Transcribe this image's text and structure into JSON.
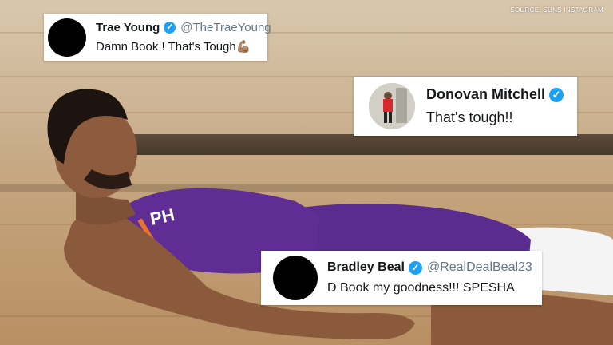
{
  "source_credit": "SOURCE: SUNS INSTAGRAM",
  "tweets": [
    {
      "name": "Trae Young",
      "handle": "@TheTraeYoung",
      "text": "Damn Book ! That's Tough",
      "emoji": "💪🏽",
      "verified_icon": "verified-badge-icon"
    },
    {
      "name": "Donovan Mitchell",
      "handle": "",
      "text": "That's tough!!",
      "verified_icon": "verified-badge-icon"
    },
    {
      "name": "Bradley Beal",
      "handle": "@RealDealBeal23",
      "text": "D Book my goodness!!! SPESHA",
      "verified_icon": "verified-badge-icon"
    }
  ],
  "colors": {
    "verified": "#1da1f2",
    "jersey": "#5b2c8f",
    "court": "#c9ab84"
  }
}
